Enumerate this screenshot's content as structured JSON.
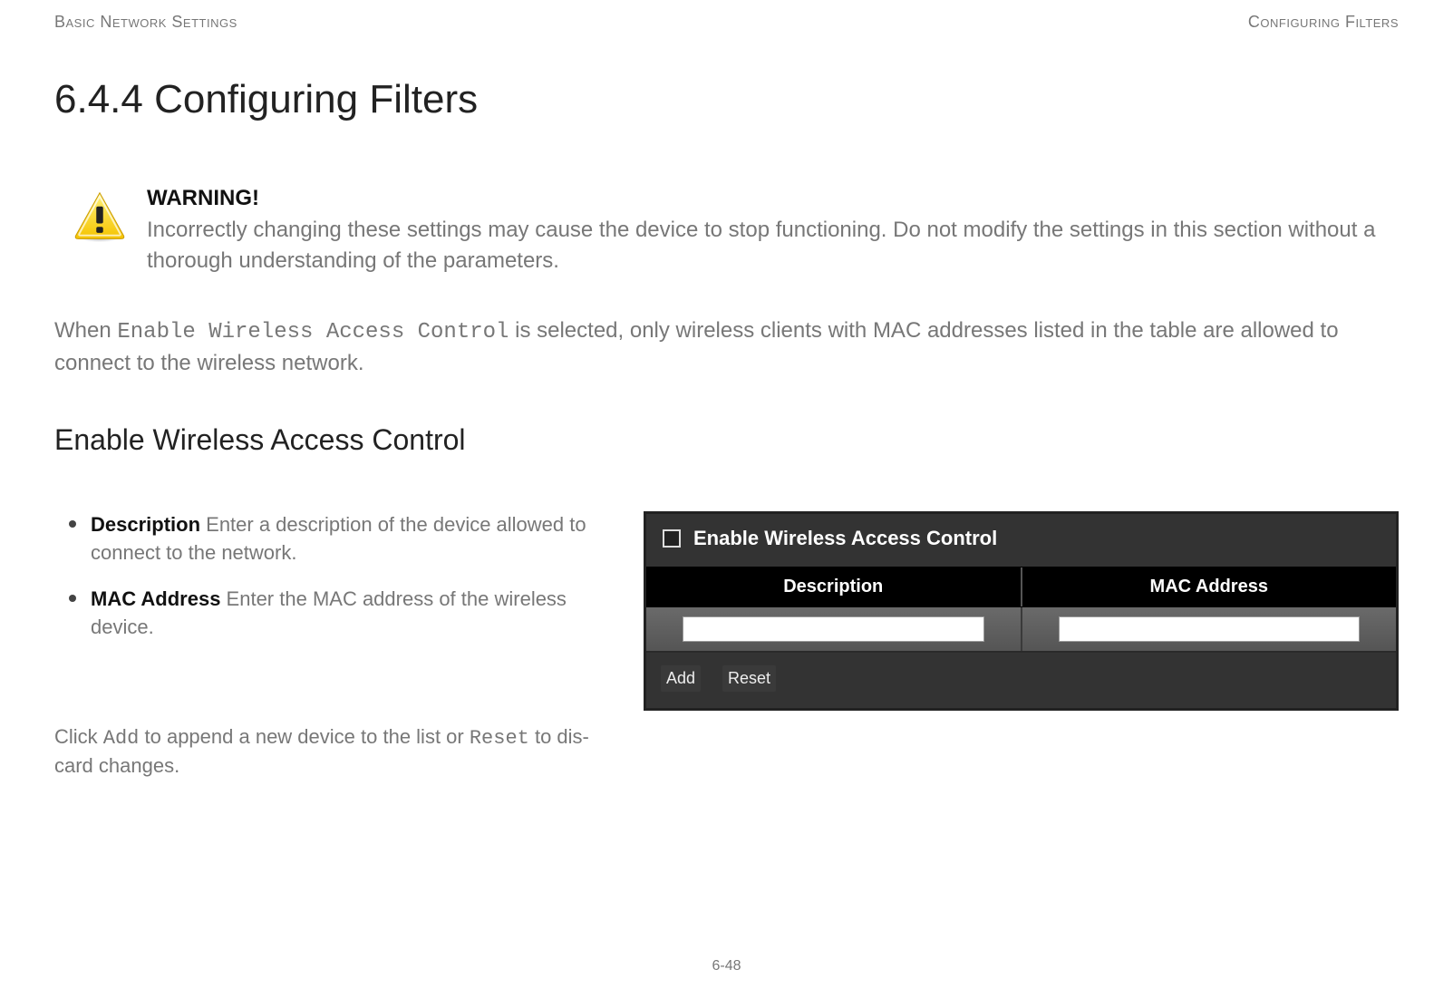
{
  "header": {
    "left": "Basic Network Settings",
    "right": "Configuring Filters"
  },
  "title": "6.4.4 Configuring Filters",
  "warning": {
    "title": "WARNING!",
    "body": "Incorrectly changing these settings may cause the device to stop functioning. Do not modify the settings in this section without a thorough understanding of the parameters."
  },
  "intro": {
    "prefix": "When ",
    "code": "Enable Wireless Access Control",
    "suffix": " is selected, only wireless clients with MAC addresses listed in the table are allowed to connect to the wireless network."
  },
  "subhead": "Enable Wireless Access Control",
  "bullets": [
    {
      "label": "Description",
      "text": "  Enter a description of the device allowed to connect to the network."
    },
    {
      "label": "MAC Address",
      "text": "  Enter the MAC address of the wireless device."
    }
  ],
  "after": {
    "p1a": "Click ",
    "code1": "Add",
    "p1b": " to append a new device to the list or ",
    "code2": "Reset",
    "p1c": " to dis-",
    "p2": "card changes."
  },
  "panel": {
    "checkbox_label": "Enable Wireless Access Control",
    "col1": "Description",
    "col2": "MAC Address",
    "input1": "",
    "input2": "",
    "btn_add": "Add",
    "btn_reset": "Reset"
  },
  "page_number": "6-48"
}
